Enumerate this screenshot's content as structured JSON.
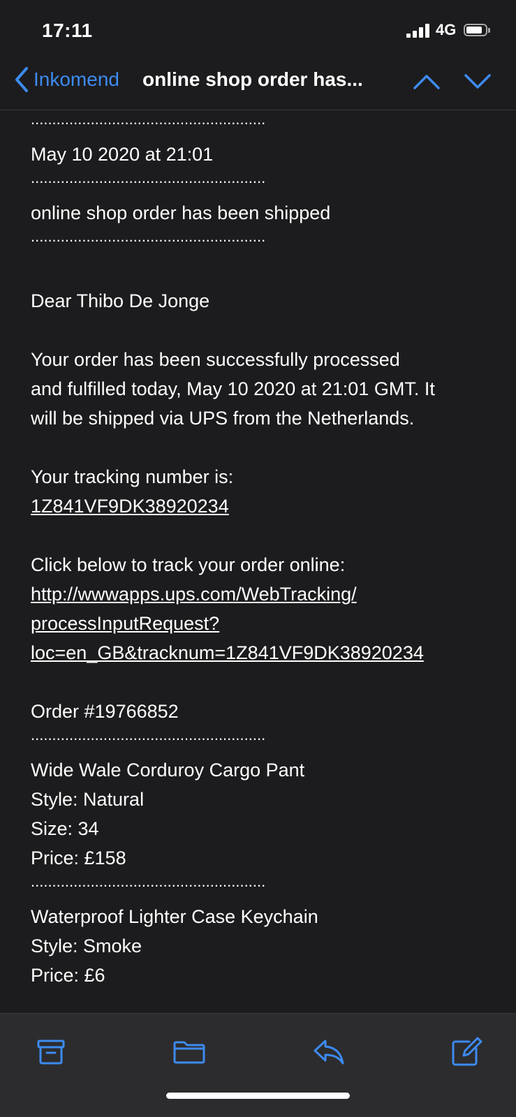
{
  "status_bar": {
    "time": "17:11",
    "network": "4G",
    "battery_level": 0.85
  },
  "nav": {
    "back_label": "Inkomend",
    "title": "online shop order has...",
    "accent_color": "#3d8bf0"
  },
  "email": {
    "separator": ".......................................................",
    "date": "May 10 2020 at 21:01",
    "subject": "online shop order has been shipped",
    "greeting": "Dear Thibo De Jonge",
    "paragraph1": [
      "Your order has been successfully processed",
      "and fulfilled today, May 10 2020 at 21:01 GMT. It",
      "will be shipped via UPS from the Netherlands."
    ],
    "tracking_label": "Your tracking number is:",
    "tracking_number": "1Z841VF9DK38920234",
    "track_label": "Click below to track your order online:",
    "track_link": [
      "http://wwwapps.ups.com/WebTracking/",
      "processInputRequest?",
      "loc=en_GB&tracknum=1Z841VF9DK38920234"
    ],
    "order_number": "Order #19766852",
    "items": [
      {
        "name": "Wide Wale Corduroy Cargo Pant",
        "style": "Style: Natural",
        "size": "Size: 34",
        "price": "Price: £158"
      },
      {
        "name": "Waterproof Lighter Case Keychain",
        "style": "Style: Smoke",
        "price": "Price: £6"
      }
    ]
  },
  "toolbar": {
    "icons": [
      "archive-icon",
      "folder-icon",
      "reply-icon",
      "compose-icon"
    ],
    "icon_color": "#3d8bf0"
  }
}
